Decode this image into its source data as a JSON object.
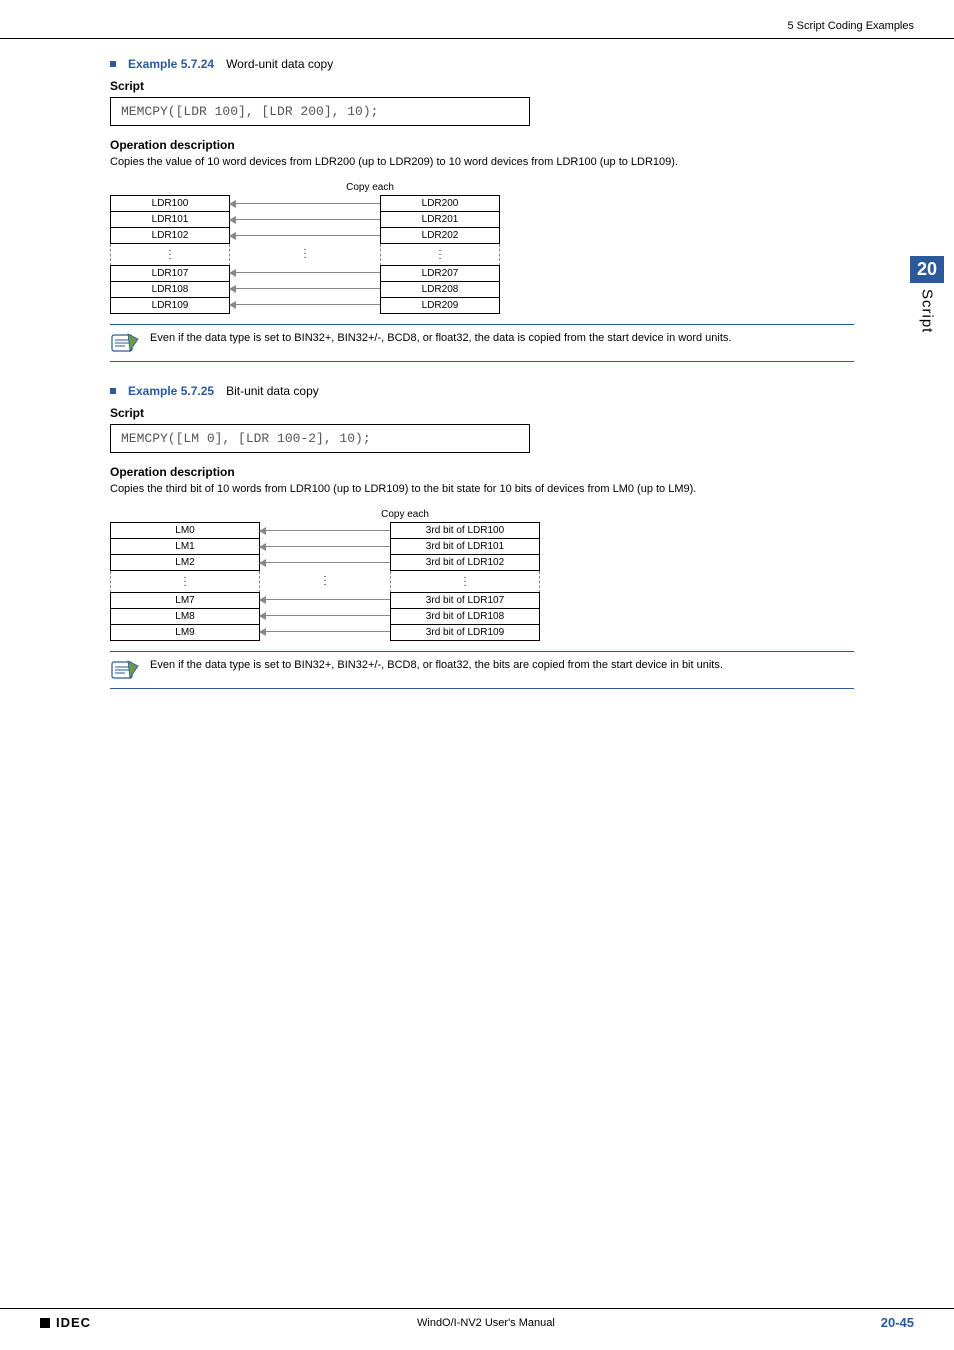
{
  "header": {
    "right": "5 Script Coding Examples"
  },
  "sideTab": {
    "num": "20",
    "label": "Script"
  },
  "ex1": {
    "bulletLabel": "Example 5.7.24",
    "title": "Word-unit data copy",
    "scriptLabel": "Script",
    "code": "MEMCPY([LDR 100], [LDR 200], 10);",
    "opLabel": "Operation description",
    "opText": "Copies the value of 10 word devices from LDR200 (up to LDR209) to 10 word devices from LDR100 (up to LDR109).",
    "copyEach": "Copy each",
    "left": [
      "LDR100",
      "LDR101",
      "LDR102",
      "LDR107",
      "LDR108",
      "LDR109"
    ],
    "right": [
      "LDR200",
      "LDR201",
      "LDR202",
      "LDR207",
      "LDR208",
      "LDR209"
    ],
    "note": "Even if the data type is set to BIN32+, BIN32+/-, BCD8, or float32, the data is copied from the start device in word units."
  },
  "ex2": {
    "bulletLabel": "Example 5.7.25",
    "title": "Bit-unit data copy",
    "scriptLabel": "Script",
    "code": "MEMCPY([LM 0], [LDR 100-2], 10);",
    "opLabel": "Operation description",
    "opText": "Copies the third bit of 10 words from LDR100 (up to LDR109) to the bit state for 10 bits of devices from LM0 (up to LM9).",
    "copyEach": "Copy each",
    "left": [
      "LM0",
      "LM1",
      "LM2",
      "LM7",
      "LM8",
      "LM9"
    ],
    "right": [
      "3rd bit of LDR100",
      "3rd bit of LDR101",
      "3rd bit of LDR102",
      "3rd bit of LDR107",
      "3rd bit of LDR108",
      "3rd bit of LDR109"
    ],
    "note": "Even if the data type is set to BIN32+, BIN32+/-, BCD8, or float32, the bits are copied from the start device in bit units."
  },
  "footer": {
    "brand": "IDEC",
    "center": "WindO/I-NV2 User's Manual",
    "page": "20-45"
  }
}
